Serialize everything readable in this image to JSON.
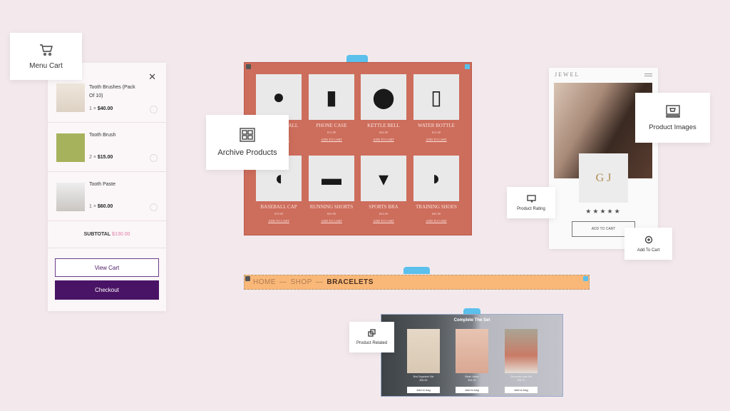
{
  "menu_cart": {
    "label": "Menu Cart",
    "icon": "cart-icon"
  },
  "cart": {
    "close_icon": "close-icon",
    "items": [
      {
        "name": "Tooth Brushes (Pack Of 10)",
        "qty": "1 ×",
        "price": "$40.00"
      },
      {
        "name": "Tooth Brush",
        "qty": "2 ×",
        "price": "$15.00"
      },
      {
        "name": "Tooth Paste",
        "qty": "1 ×",
        "price": "$60.00"
      }
    ],
    "subtotal_label": "SUBTOTAL",
    "subtotal_value": "$130.00",
    "view_cart": "View Cart",
    "checkout": "Checkout",
    "colors": {
      "checkout": "#4a1466",
      "subtotal": "#e07aa8"
    }
  },
  "archive": {
    "label": "Archive Products",
    "icon": "archive-grid-icon",
    "bg_color": "#cd6d5c",
    "products": [
      {
        "name": "MEDICINE BALL",
        "price": "$22.00",
        "add": "ADD TO CART"
      },
      {
        "name": "PHONE CASE",
        "price": "$13.00",
        "add": "ADD TO CART"
      },
      {
        "name": "KETTLE BELL",
        "price": "$44.00",
        "add": "ADD TO CART"
      },
      {
        "name": "WATER BOTTLE",
        "price": "$12.00",
        "add": "ADD TO CART"
      },
      {
        "name": "BASEBALL CAP",
        "price": "$18.00",
        "add": "ADD TO CART"
      },
      {
        "name": "RUNNING SHORTS",
        "price": "$26.00",
        "add": "ADD TO CART"
      },
      {
        "name": "SPORTS BRA",
        "price": "$24.00",
        "add": "ADD TO CART"
      },
      {
        "name": "TRAINING SHOES",
        "price": "$46.00",
        "add": "ADD TO CART"
      }
    ]
  },
  "breadcrumb": {
    "items": [
      "HOME",
      "SHOP",
      "BRACELETS"
    ],
    "separator": "—",
    "bg_color": "#f9b877"
  },
  "related": {
    "label": "Product Related",
    "title": "Complete The Set",
    "products": [
      {
        "name": "Bird Organizer Set",
        "price": "$30.00",
        "button": "Add to bag"
      },
      {
        "name": "Blush Vases",
        "price": "$24.00",
        "button": "Add to bag"
      },
      {
        "name": "Terracotta Vase Set",
        "price": "$36.00",
        "button": "Add to bag"
      }
    ]
  },
  "jewel": {
    "brand": "JEWEL",
    "rating": 5,
    "add_to_cart": "ADD TO CART",
    "product_images_label": "Product Images",
    "product_rating_label": "Product Rating",
    "add_to_cart_label": "Add To Cart"
  },
  "accent_color": "#5bc0eb"
}
